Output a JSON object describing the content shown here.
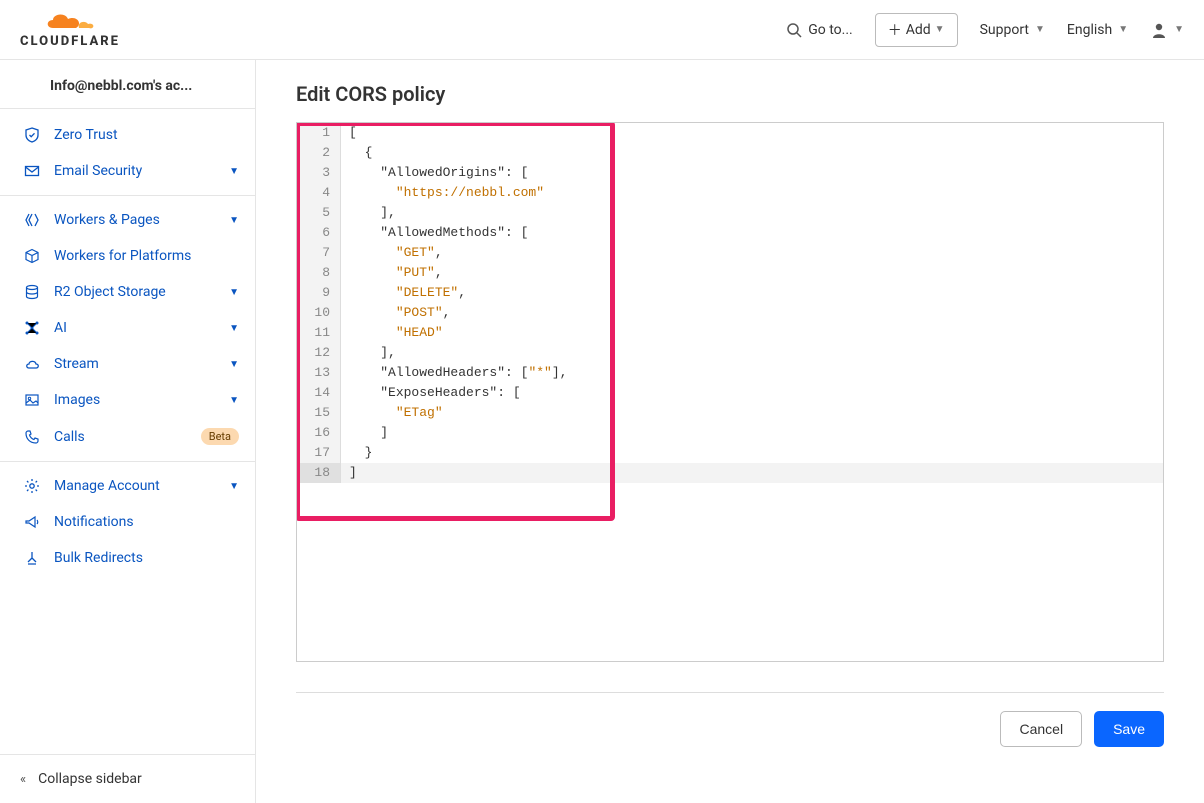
{
  "topbar": {
    "goto": "Go to...",
    "add": "Add",
    "support": "Support",
    "language": "English"
  },
  "sidebar": {
    "account": "Info@nebbl.com's ac...",
    "items": {
      "zero_trust": "Zero Trust",
      "email_security": "Email Security",
      "workers_pages": "Workers & Pages",
      "workers_platforms": "Workers for Platforms",
      "r2": "R2 Object Storage",
      "ai": "AI",
      "stream": "Stream",
      "images": "Images",
      "calls": "Calls",
      "calls_badge": "Beta",
      "manage_account": "Manage Account",
      "notifications": "Notifications",
      "bulk_redirects": "Bulk Redirects"
    },
    "collapse": "Collapse sidebar"
  },
  "main": {
    "title": "Edit CORS policy",
    "code_lines": [
      "[",
      "  {",
      "    \"AllowedOrigins\": [",
      "      \"https://nebbl.com\"",
      "    ],",
      "    \"AllowedMethods\": [",
      "      \"GET\",",
      "      \"PUT\",",
      "      \"DELETE\",",
      "      \"POST\",",
      "      \"HEAD\"",
      "    ],",
      "    \"AllowedHeaders\": [\"*\"],",
      "    \"ExposeHeaders\": [",
      "      \"ETag\"",
      "    ]",
      "  }",
      "]"
    ],
    "cancel": "Cancel",
    "save": "Save"
  }
}
